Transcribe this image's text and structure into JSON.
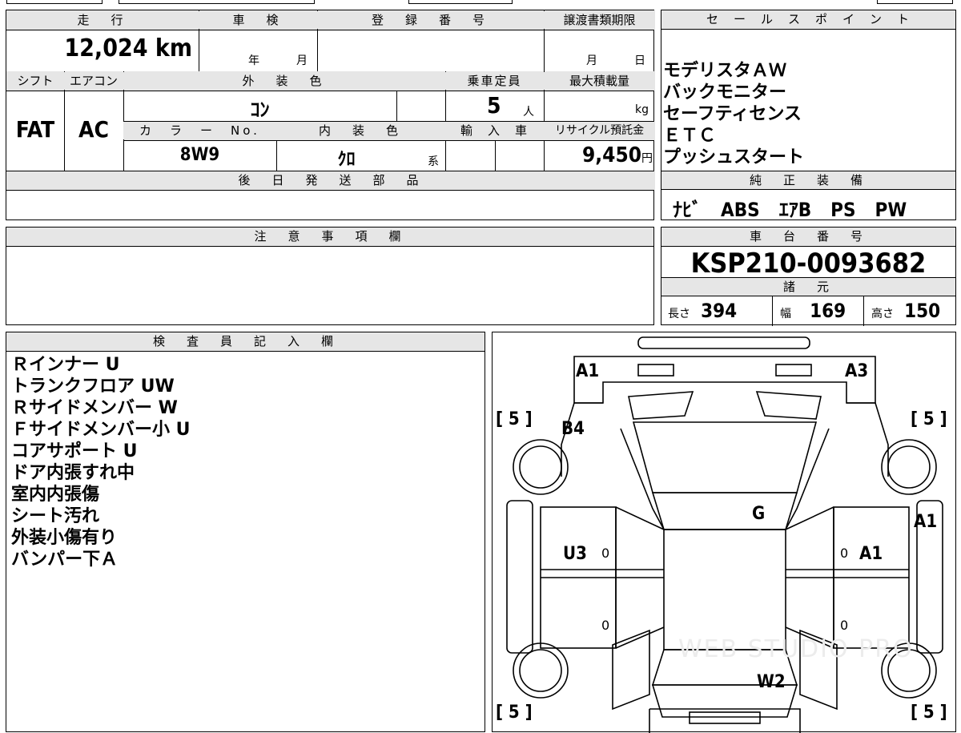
{
  "top_table": {
    "headers": {
      "mileage": "走　行",
      "inspection": "車　検",
      "registration_no": "登　録　番　号",
      "transfer_deadline": "譲渡書類期限",
      "shift": "シフト",
      "aircon": "エアコン",
      "exterior_color": "外　装　色",
      "capacity": "乗車定員",
      "max_load": "最大積載量",
      "color_no": "カ　ラ　ー　No.",
      "interior_color": "内　装　色",
      "import": "輸　入　車",
      "recycle_fee": "リサイクル預託金",
      "later_parts": "後　日　発　送　部　品"
    },
    "values": {
      "mileage": "12,024",
      "mileage_unit": "km",
      "inspection_year": "年",
      "inspection_month": "月",
      "transfer_month": "月",
      "transfer_day": "日",
      "shift": "FAT",
      "aircon": "AC",
      "exterior_color": "ｺﾝ",
      "capacity": "5",
      "capacity_unit": "人",
      "max_load_unit": "kg",
      "color_no": "8W9",
      "interior_color": "ｸﾛ",
      "interior_suffix": "系",
      "recycle_fee": "9,450",
      "recycle_unit": "円"
    }
  },
  "sales_points": {
    "header": "セ　ー　ル　ス　ポ　イ　ン　ト",
    "items": [
      "モデリスタＡＷ",
      "バックモニター",
      "セーフティセンス",
      "ＥＴＣ",
      "プッシュスタート"
    ]
  },
  "genuine_equipment": {
    "header": "純　正　装　備",
    "value": "ﾅﾋﾞ　ABS　ｴｱB　PS　PW"
  },
  "caution": {
    "header": "注　意　事　項　欄"
  },
  "chassis": {
    "header": "車　台　番　号",
    "value": "KSP210-0093682",
    "specs_header": "諸　元",
    "length_label": "長さ",
    "length": "394",
    "width_label": "幅",
    "width": "169",
    "height_label": "高さ",
    "height": "150"
  },
  "inspector": {
    "header": "検　査　員　記　入　欄",
    "notes": [
      "Ｒインナー U",
      "トランクフロア UW",
      "Ｒサイドメンバー W",
      "Ｆサイドメンバー小 U",
      "コアサポート U",
      "ドア内張すれ中",
      "室内内張傷",
      "シート汚れ",
      "外装小傷有り",
      "バンパー下Ａ"
    ]
  },
  "diagram": {
    "marks": {
      "front_left": "A1",
      "front_right": "A3",
      "left_fender": "B4",
      "hood": "G",
      "right_fender": "A1",
      "left_door": "U3",
      "right_door": "A1",
      "rear": "W2"
    },
    "tire_fl": "[ 5 ]",
    "tire_fr": "[ 5 ]",
    "tire_rl": "[ 5 ]",
    "tire_rr": "[ 5 ]",
    "zeros": [
      "0",
      "0",
      "0",
      "0"
    ],
    "watermark": "WEB STUDIO PRO"
  }
}
